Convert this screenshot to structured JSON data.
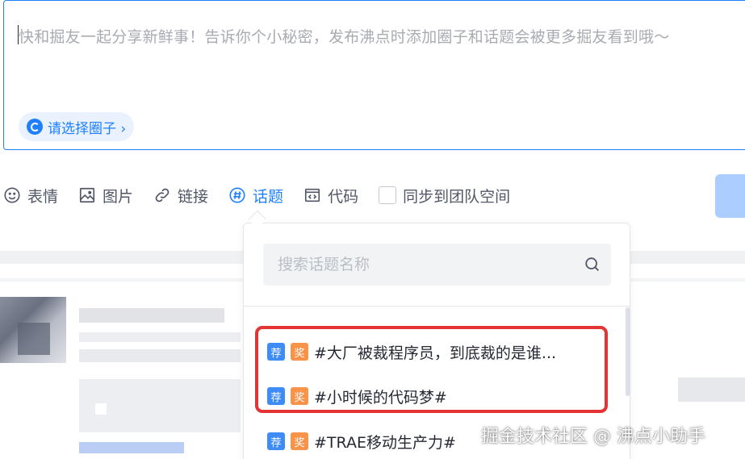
{
  "composer": {
    "placeholder": "快和掘友一起分享新鲜事！告诉你个小秘密，发布沸点时添加圈子和话题会被更多掘友看到哦～",
    "circle_button": "请选择圈子 ›"
  },
  "toolbar": {
    "emoji": "表情",
    "image": "图片",
    "link": "链接",
    "topic": "话题",
    "code": "代码",
    "sync": "同步到团队空间"
  },
  "topic_popover": {
    "search_placeholder": "搜索话题名称",
    "topics": [
      {
        "tag1": "荐",
        "tag2": "奖",
        "label": "#大厂被裁程序员，到底裁的是谁..."
      },
      {
        "tag1": "荐",
        "tag2": "奖",
        "label": "#小时候的代码梦#"
      },
      {
        "tag1": "荐",
        "tag2": "奖",
        "label": "#TRAE移动生产力#"
      }
    ]
  },
  "watermark": "掘金技术社区 @ 沸点小助手",
  "colors": {
    "accent": "#1e80ff",
    "highlight": "#e43434",
    "tag_recommend": "#3f8cf7",
    "tag_award": "#f7944a"
  }
}
